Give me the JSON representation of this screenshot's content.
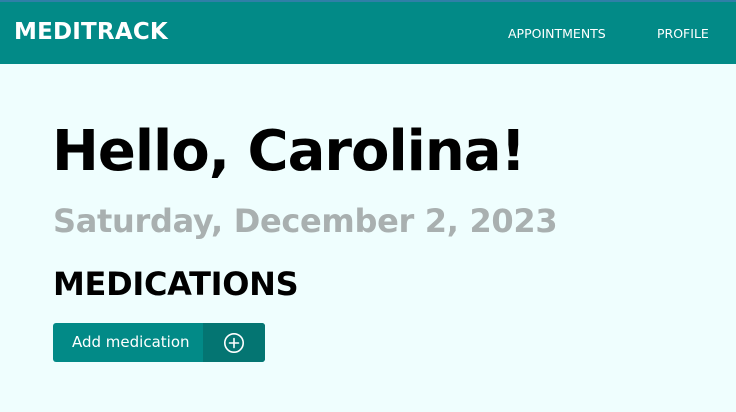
{
  "header": {
    "brand": "MEDITRACK",
    "nav": [
      {
        "label": "APPOINTMENTS"
      },
      {
        "label": "PROFILE"
      }
    ]
  },
  "main": {
    "greeting": "Hello, Carolina!",
    "date": "Saturday, December 2, 2023",
    "section_title": "MEDICATIONS",
    "add_button": {
      "label": "Add medication",
      "icon": "plus-circle-icon"
    }
  },
  "colors": {
    "primary": "#028a87",
    "primary_dark": "#047572",
    "background": "#effefe",
    "muted_text": "#a9b0b0"
  }
}
